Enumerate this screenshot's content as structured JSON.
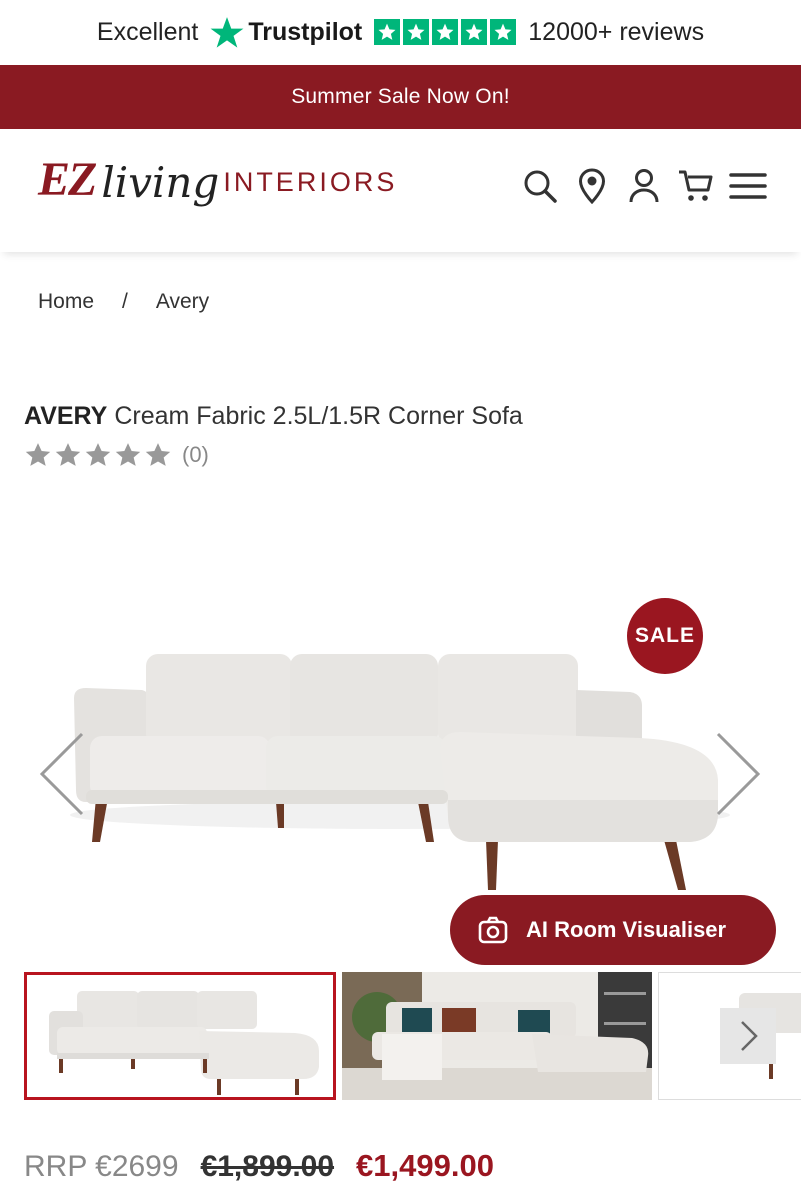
{
  "trustpilot": {
    "rating_word": "Excellent",
    "brand": "Trustpilot",
    "stars": 5,
    "reviews": "12000+ reviews",
    "color": "#00b67a"
  },
  "promo": {
    "text": "Summer Sale Now On!",
    "color": "#8a1a22"
  },
  "header": {
    "logo": {
      "ez": "EZ",
      "living": "living",
      "interiors": "INTERIORS"
    },
    "icons": [
      "search-icon",
      "location-pin-icon",
      "account-icon",
      "cart-icon",
      "menu-icon"
    ]
  },
  "breadcrumb": {
    "home": "Home",
    "separator": "/",
    "current": "Avery"
  },
  "product": {
    "name_bold": "AVERY",
    "name_rest": "Cream Fabric 2.5L/1.5R Corner Sofa",
    "rating_stars": 0,
    "rating_count": "(0)",
    "sale_badge": "SALE",
    "ai_button": "AI Room Visualiser",
    "rrp": "RRP €2699",
    "was_price": "€1,899.00",
    "now_price": "€1,499.00",
    "accent_color": "#9a1620"
  }
}
